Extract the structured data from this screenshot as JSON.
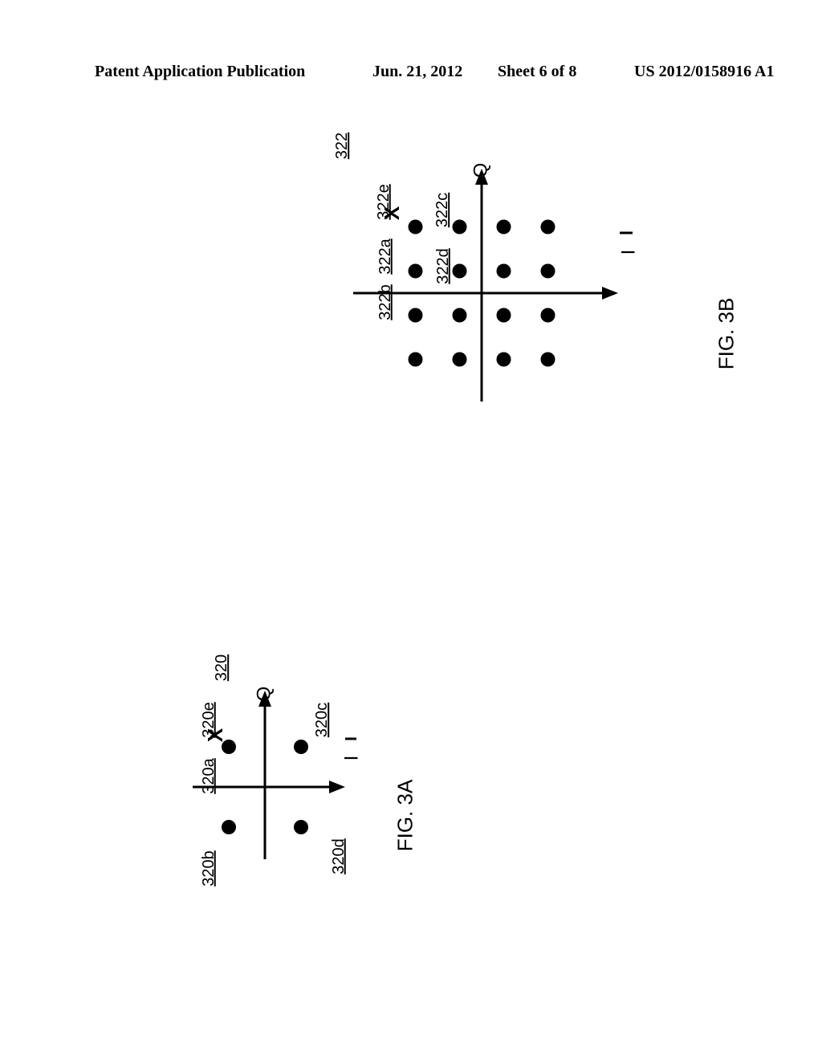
{
  "header": {
    "pub_label": "Patent Application Publication",
    "pub_date": "Jun. 21, 2012",
    "sheet": "Sheet 6 of 8",
    "pub_no": "US 2012/0158916 A1"
  },
  "figA": {
    "ref": "320",
    "caption": "FIG. 3A",
    "axis_q": "Q",
    "axis_i": "I",
    "e_mark": "X",
    "labels": {
      "a": "320a",
      "b": "320b",
      "c": "320c",
      "d": "320d",
      "e": "320e"
    }
  },
  "figB": {
    "ref": "322",
    "caption": "FIG. 3B",
    "axis_q": "Q",
    "axis_i": "I",
    "e_mark": "X",
    "labels": {
      "a": "322a",
      "b": "322b",
      "c": "322c",
      "d": "322d",
      "e": "322e"
    }
  },
  "chart_data": [
    {
      "type": "scatter",
      "title": "FIG. 3A",
      "xlabel": "I",
      "ylabel": "Q",
      "xlim": [
        -1.5,
        1.5
      ],
      "ylim": [
        -1.5,
        1.5
      ],
      "series": [
        {
          "name": "constellation-points",
          "points": [
            [
              -1,
              1
            ],
            [
              1,
              1
            ],
            [
              -1,
              -1
            ],
            [
              1,
              -1
            ]
          ]
        },
        {
          "name": "received-symbol-x",
          "points": [
            [
              -1.3,
              1.3
            ]
          ]
        }
      ],
      "annotations": {
        "320a": [
          -1,
          1
        ],
        "320b": [
          -1,
          -1
        ],
        "320c": [
          1,
          1
        ],
        "320d": [
          1,
          -1
        ],
        "320e": [
          -1.3,
          1.3
        ]
      }
    },
    {
      "type": "scatter",
      "title": "FIG. 3B",
      "xlabel": "I",
      "ylabel": "Q",
      "xlim": [
        -4,
        4
      ],
      "ylim": [
        -4,
        4
      ],
      "series": [
        {
          "name": "constellation-points",
          "points": [
            [
              -3,
              3
            ],
            [
              -1,
              3
            ],
            [
              1,
              3
            ],
            [
              3,
              3
            ],
            [
              -3,
              1
            ],
            [
              -1,
              1
            ],
            [
              1,
              1
            ],
            [
              3,
              1
            ],
            [
              -3,
              -1
            ],
            [
              -1,
              -1
            ],
            [
              1,
              -1
            ],
            [
              3,
              -1
            ],
            [
              -3,
              -3
            ],
            [
              -1,
              -3
            ],
            [
              1,
              -3
            ],
            [
              3,
              -3
            ]
          ]
        },
        {
          "name": "received-symbol-x",
          "points": [
            [
              -3.5,
              3.5
            ]
          ]
        }
      ],
      "annotations": {
        "322a": [
          -3,
          3
        ],
        "322b": [
          -3,
          1
        ],
        "322c": [
          -1,
          3
        ],
        "322d": [
          -1,
          1
        ],
        "322e": [
          -3.5,
          3.5
        ]
      }
    }
  ]
}
